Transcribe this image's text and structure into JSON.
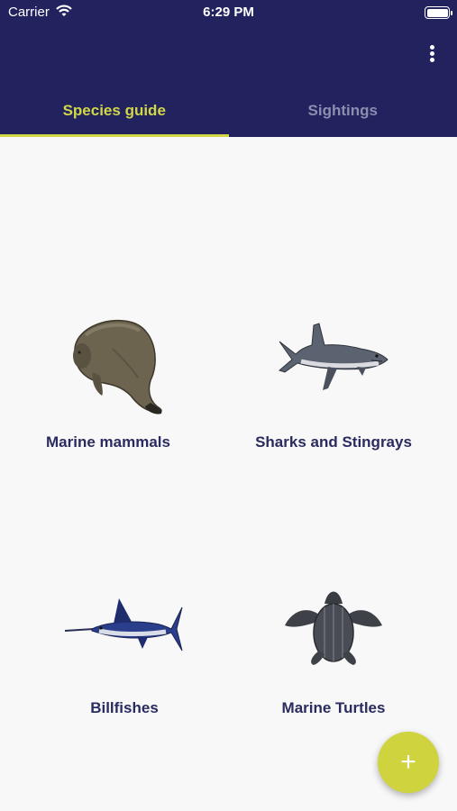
{
  "status_bar": {
    "carrier": "Carrier",
    "time": "6:29 PM"
  },
  "tabs": [
    {
      "label": "Species guide",
      "active": true
    },
    {
      "label": "Sightings",
      "active": false
    }
  ],
  "categories": [
    {
      "label": "Marine mammals",
      "icon": "manatee-icon"
    },
    {
      "label": "Sharks and Stingrays",
      "icon": "shark-icon"
    },
    {
      "label": "Billfishes",
      "icon": "marlin-icon"
    },
    {
      "label": "Marine Turtles",
      "icon": "turtle-icon"
    }
  ],
  "fab": {
    "icon": "plus-icon",
    "symbol": "+"
  },
  "colors": {
    "primary": "#21225e",
    "accent": "#d2d748",
    "background": "#f8f8f8",
    "label": "#2a2b5e"
  }
}
